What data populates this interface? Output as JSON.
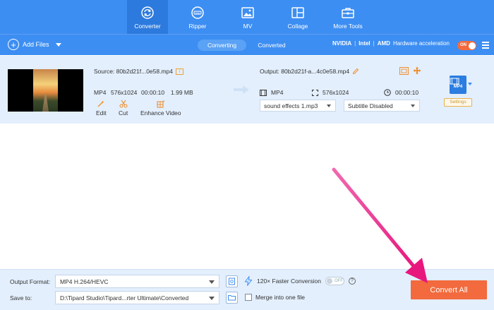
{
  "nav": {
    "tabs": [
      {
        "label": "Converter",
        "icon": "converter-icon",
        "active": true
      },
      {
        "label": "Ripper",
        "icon": "ripper-icon",
        "active": false
      },
      {
        "label": "MV",
        "icon": "mv-icon",
        "active": false
      },
      {
        "label": "Collage",
        "icon": "collage-icon",
        "active": false
      },
      {
        "label": "More Tools",
        "icon": "toolbox-icon",
        "active": false
      }
    ]
  },
  "toolbar": {
    "add_files": "Add Files",
    "seg_converting": "Converting",
    "seg_converted": "Converted",
    "hw_nvidia": "NVIDIA",
    "hw_intel": "Intel",
    "hw_amd": "AMD",
    "hw_label": "Hardware acceleration",
    "hw_toggle": "ON"
  },
  "file": {
    "source": "Source: 80b2d21f...0e58.mp4",
    "src_format": "MP4",
    "src_resolution": "576x1024",
    "src_duration": "00:00:10",
    "src_size": "1.99 MB",
    "action_edit": "Edit",
    "action_cut": "Cut",
    "action_enhance": "Enhance Video",
    "output": "Output: 80b2d21f-a...4c0e58.mp4",
    "out_format": "MP4",
    "out_resolution": "576x1024",
    "out_duration": "00:00:10",
    "audio_track": "sound effects 1.mp3",
    "subtitle": "Subtitle Disabled",
    "fmt_icon_text": "MP4",
    "settings": "Settings"
  },
  "bottom": {
    "output_format_label": "Output Format:",
    "output_format_value": "MP4 H.264/HEVC",
    "save_to_label": "Save to:",
    "save_to_value": "D:\\Tipard Studio\\Tipard...rter Ultimate\\Converted",
    "faster_label": "120× Faster Conversion",
    "faster_toggle": "OFF",
    "merge_label": "Merge into one file",
    "convert_all": "Convert All"
  },
  "colors": {
    "primary": "#3d8ef2",
    "accent": "#f26a3d",
    "annotation_arrow": "#e8177e"
  }
}
